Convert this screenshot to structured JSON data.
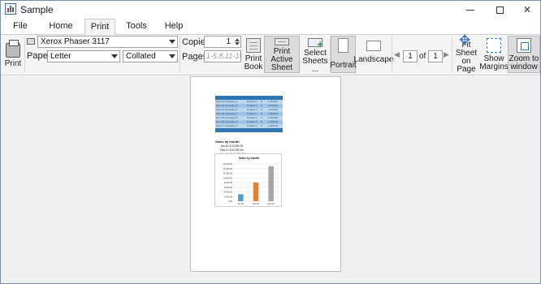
{
  "window": {
    "title": "Sample"
  },
  "tabs": [
    "File",
    "Home",
    "Print",
    "Tools",
    "Help"
  ],
  "active_tab": "Print",
  "ribbon": {
    "print_label": "Print",
    "printer": "Xerox Phaser 3117",
    "paper_label": "Paper:",
    "paper": "Letter",
    "collation": "Collated",
    "copies_label": "Copies:",
    "copies": "1",
    "pages_label": "Pages:",
    "pages_placeholder": "1-5,8,11-15",
    "print_book": "Print Book",
    "print_active_sheet": "Print Active Sheet",
    "select_sheets": "Select Sheets ...",
    "portrait": "Portrait",
    "landscape": "Landscape",
    "page_current": "1",
    "page_of": "of",
    "page_total": "1",
    "fit_sheet": "Fit Sheet on Page",
    "show_margins": "Show Margins",
    "zoom_to_window": "Zoom to window"
  },
  "preview": {
    "table_rows": [
      [
        "Item 01 Company A",
        "Product 1",
        "8",
        "1,250.00"
      ],
      [
        "Item 02 Company B",
        "Product 2",
        "3",
        "1,200.00"
      ],
      [
        "Item 03 Company A",
        "Product 3",
        "5",
        "1,025.00"
      ],
      [
        "Item 04 Company C",
        "Product 1",
        "8",
        "1,250.00"
      ],
      [
        "Item 05 Company B",
        "Product 2",
        "2",
        "1,300.00"
      ],
      [
        "Item 06 Company A",
        "Product 3",
        "8",
        "1,250.00"
      ],
      [
        "Item 07 Company C",
        "Product 1",
        "4",
        "1,225.00"
      ]
    ],
    "summary_title": "Sales by month",
    "summary_lines": [
      "Jan-01 $ 3,000.00",
      "Feb-01 $ 8,000.00",
      "Mar-01 $ 15,000.00"
    ],
    "chart_data": {
      "type": "bar",
      "title": "Sales by month",
      "categories": [
        "Jan-01",
        "Feb-01",
        "Mar-01"
      ],
      "values": [
        3000,
        8000,
        15000
      ],
      "ylim": [
        0,
        16000
      ],
      "yticks": [
        "16,000.00",
        "14,000.00",
        "12,000.00",
        "10,000.00",
        "8,000.00",
        "6,000.00",
        "4,000.00",
        "2,000.00",
        "0.00"
      ],
      "colors": [
        "#5b9bd5",
        "#ed7d31",
        "#a5a5a5"
      ]
    }
  }
}
